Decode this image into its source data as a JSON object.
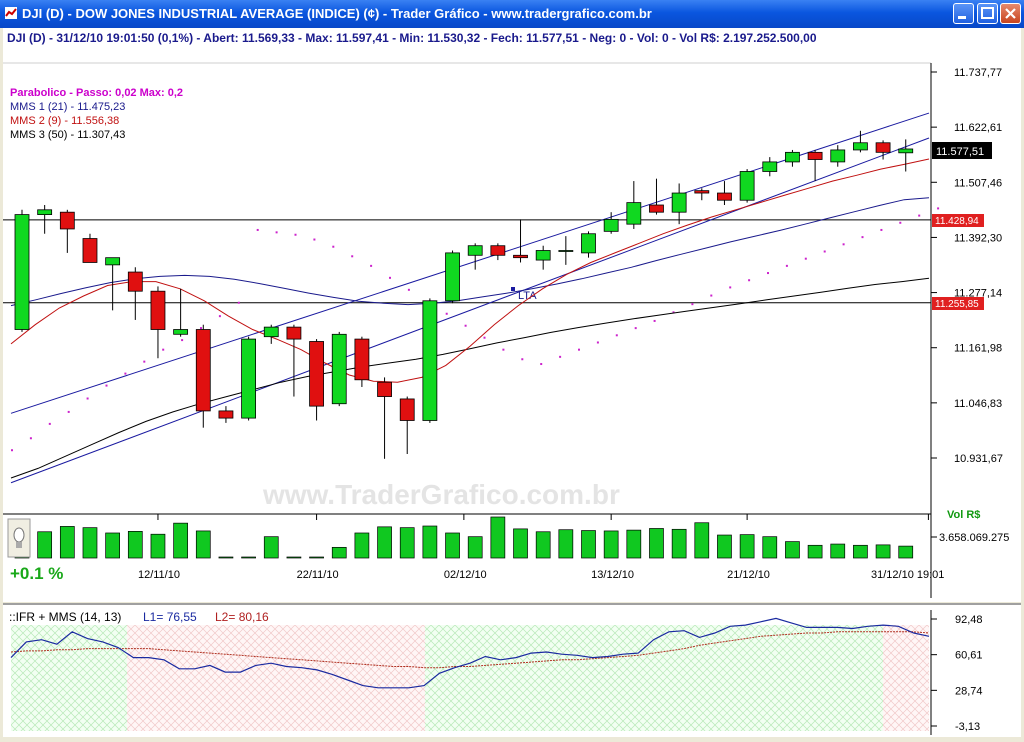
{
  "window": {
    "title": "DJI (D) - DOW JONES INDUSTRIAL AVERAGE (INDICE) (¢) - Trader Gráfico - www.tradergrafico.com.br",
    "colors": {
      "titlebar": "#0a56df",
      "up": "#10d820",
      "down": "#e01010"
    }
  },
  "info_bar": "DJI (D) - 31/12/10 19:01:50 (0,1%) - Abert: 11.569,33 - Max: 11.597,41 - Min: 11.530,32 - Fech: 11.577,51 - Neg: 0 - Vol: 0 - Vol R$: 2.197.252.500,00",
  "legend": {
    "parabolic": "Parabolico - Passo: 0,02  Max: 0,2",
    "mms1": "MMS 1 (21) - 11.475,23",
    "mms2": "MMS 2 (9) - 11.556,38",
    "mms3": "MMS 3 (50) - 11.307,43"
  },
  "watermark": "www.TraderGrafico.com.br",
  "change_label": "+0.1 %",
  "volume_label": "Vol R$",
  "volume_tick": "3.658.069.275",
  "price_badges": {
    "last": "11.577,51",
    "upper": "11.428,94",
    "lower": "11.255,85"
  },
  "trendline_label": "LTA",
  "indicator": {
    "title": "::IFR + MMS (14, 13)",
    "l1": "L1= 76,55",
    "l2": "L2= 80,16",
    "ticks": [
      "92,48",
      "60,61",
      "28,74",
      "-3,13"
    ],
    "l1_values": [
      58,
      72,
      74,
      70,
      81,
      75,
      72,
      67,
      58,
      58,
      56,
      48,
      48,
      51,
      45,
      45,
      51,
      53,
      50,
      49,
      47,
      43,
      38,
      33,
      31,
      31,
      31,
      33,
      44,
      49,
      53,
      59,
      56,
      58,
      62,
      63,
      61,
      60,
      58,
      59,
      61,
      62,
      74,
      81,
      82,
      76,
      80,
      86,
      87,
      90,
      93,
      89,
      85,
      85,
      85,
      84,
      86,
      87,
      86,
      80,
      77
    ],
    "l2_values": [
      63,
      64,
      64,
      65,
      65,
      66,
      66,
      66,
      66,
      66,
      65,
      64,
      63,
      62,
      61,
      60,
      59,
      58,
      57,
      56,
      55,
      54,
      53,
      52,
      51,
      50,
      50,
      49,
      49,
      50,
      50,
      51,
      52,
      53,
      54,
      55,
      56,
      56,
      57,
      58,
      59,
      60,
      62,
      64,
      66,
      69,
      71,
      73,
      75,
      77,
      78,
      79,
      80,
      80,
      81,
      81,
      81,
      81,
      81,
      81,
      80
    ]
  },
  "chart_data": {
    "type": "candlestick",
    "y_ticks": [
      "11.737,77",
      "11.622,61",
      "11.507,46",
      "11.392,30",
      "11.277,14",
      "11.161,98",
      "11.046,83",
      "10.931,67"
    ],
    "ylim": [
      10880,
      11780
    ],
    "x_ticks": [
      "12/11/10",
      "22/11/10",
      "02/12/10",
      "13/12/10",
      "21/12/10",
      "31/12/10 19:01"
    ],
    "candles": [
      {
        "o": 11200,
        "h": 11450,
        "l": 11195,
        "c": 11440
      },
      {
        "o": 11440,
        "h": 11460,
        "l": 11400,
        "c": 11450
      },
      {
        "o": 11445,
        "h": 11450,
        "l": 11360,
        "c": 11410
      },
      {
        "o": 11390,
        "h": 11400,
        "l": 11340,
        "c": 11340
      },
      {
        "o": 11335,
        "h": 11350,
        "l": 11240,
        "c": 11350
      },
      {
        "o": 11320,
        "h": 11330,
        "l": 11220,
        "c": 11280
      },
      {
        "o": 11280,
        "h": 11290,
        "l": 11140,
        "c": 11200
      },
      {
        "o": 11190,
        "h": 11285,
        "l": 11185,
        "c": 11200
      },
      {
        "o": 11200,
        "h": 11210,
        "l": 10995,
        "c": 11030
      },
      {
        "o": 11030,
        "h": 11040,
        "l": 11005,
        "c": 11015
      },
      {
        "o": 11015,
        "h": 11185,
        "l": 11010,
        "c": 11180
      },
      {
        "o": 11185,
        "h": 11210,
        "l": 11170,
        "c": 11205
      },
      {
        "o": 11205,
        "h": 11210,
        "l": 11060,
        "c": 11180
      },
      {
        "o": 11175,
        "h": 11180,
        "l": 11010,
        "c": 11040
      },
      {
        "o": 11045,
        "h": 11195,
        "l": 11040,
        "c": 11190
      },
      {
        "o": 11180,
        "h": 11185,
        "l": 11080,
        "c": 11095
      },
      {
        "o": 11090,
        "h": 11100,
        "l": 10930,
        "c": 11060
      },
      {
        "o": 11055,
        "h": 11060,
        "l": 10940,
        "c": 11010
      },
      {
        "o": 11010,
        "h": 11265,
        "l": 11005,
        "c": 11260
      },
      {
        "o": 11260,
        "h": 11365,
        "l": 11255,
        "c": 11360
      },
      {
        "o": 11355,
        "h": 11380,
        "l": 11325,
        "c": 11375
      },
      {
        "o": 11375,
        "h": 11380,
        "l": 11345,
        "c": 11355
      },
      {
        "o": 11355,
        "h": 11430,
        "l": 11340,
        "c": 11350
      },
      {
        "o": 11345,
        "h": 11375,
        "l": 11325,
        "c": 11365
      },
      {
        "o": 11365,
        "h": 11395,
        "l": 11335,
        "c": 11365
      },
      {
        "o": 11360,
        "h": 11405,
        "l": 11350,
        "c": 11400
      },
      {
        "o": 11405,
        "h": 11445,
        "l": 11400,
        "c": 11430
      },
      {
        "o": 11420,
        "h": 11510,
        "l": 11410,
        "c": 11465
      },
      {
        "o": 11460,
        "h": 11515,
        "l": 11440,
        "c": 11445
      },
      {
        "o": 11445,
        "h": 11505,
        "l": 11420,
        "c": 11485
      },
      {
        "o": 11490,
        "h": 11495,
        "l": 11470,
        "c": 11485
      },
      {
        "o": 11485,
        "h": 11510,
        "l": 11460,
        "c": 11470
      },
      {
        "o": 11470,
        "h": 11535,
        "l": 11465,
        "c": 11530
      },
      {
        "o": 11530,
        "h": 11560,
        "l": 11520,
        "c": 11550
      },
      {
        "o": 11550,
        "h": 11575,
        "l": 11540,
        "c": 11570
      },
      {
        "o": 11570,
        "h": 11575,
        "l": 11510,
        "c": 11555
      },
      {
        "o": 11550,
        "h": 11585,
        "l": 11540,
        "c": 11575
      },
      {
        "o": 11575,
        "h": 11615,
        "l": 11570,
        "c": 11590
      },
      {
        "o": 11590,
        "h": 11595,
        "l": 11555,
        "c": 11570
      },
      {
        "o": 11569,
        "h": 11597,
        "l": 11530,
        "c": 11577
      }
    ],
    "volumes": [
      92,
      64,
      77,
      74,
      61,
      65,
      58,
      85,
      66,
      1,
      2,
      52,
      1,
      1,
      26,
      61,
      76,
      74,
      78,
      61,
      52,
      100,
      71,
      64,
      69,
      67,
      66,
      68,
      72,
      70,
      86,
      56,
      57,
      52,
      40,
      31,
      34,
      31,
      32,
      29
    ],
    "mms1_21": [
      11250,
      11262,
      11275,
      11287,
      11298,
      11306,
      11311,
      11313,
      11311,
      11305,
      11296,
      11286,
      11276,
      11267,
      11259,
      11255,
      11252,
      11255,
      11260,
      11268,
      11276,
      11285,
      11295,
      11306,
      11318,
      11330,
      11344,
      11357,
      11370,
      11383,
      11395,
      11407,
      11420,
      11433,
      11446,
      11459,
      11471,
      11475
    ],
    "mms2_9": [
      11170,
      11210,
      11245,
      11270,
      11292,
      11300,
      11300,
      11285,
      11260,
      11228,
      11200,
      11180,
      11158,
      11130,
      11105,
      11092,
      11090,
      11100,
      11125,
      11165,
      11210,
      11250,
      11285,
      11315,
      11340,
      11360,
      11380,
      11400,
      11418,
      11435,
      11450,
      11465,
      11480,
      11495,
      11510,
      11522,
      11535,
      11545,
      11556
    ],
    "mms3_50": [
      10890,
      10910,
      10935,
      10960,
      10985,
      11008,
      11028,
      11045,
      11060,
      11075,
      11090,
      11102,
      11112,
      11122,
      11130,
      11138,
      11148,
      11160,
      11172,
      11183,
      11194,
      11204,
      11213,
      11222,
      11230,
      11238,
      11246,
      11254,
      11262,
      11270,
      11278,
      11286,
      11294,
      11300,
      11307
    ],
    "parabolic": [
      10950,
      10975,
      11005,
      11030,
      11058,
      11085,
      11110,
      11135,
      11160,
      11180,
      11205,
      11230,
      11258,
      11410,
      11405,
      11400,
      11390,
      11375,
      11355,
      11335,
      11310,
      11285,
      11260,
      11235,
      11210,
      11185,
      11160,
      11140,
      11130,
      11145,
      11160,
      11175,
      11190,
      11205,
      11220,
      11238,
      11255,
      11273,
      11290,
      11305,
      11320,
      11335,
      11350,
      11365,
      11380,
      11395,
      11410,
      11425,
      11440,
      11455
    ],
    "hlines": [
      11428.94,
      11255.85
    ]
  }
}
